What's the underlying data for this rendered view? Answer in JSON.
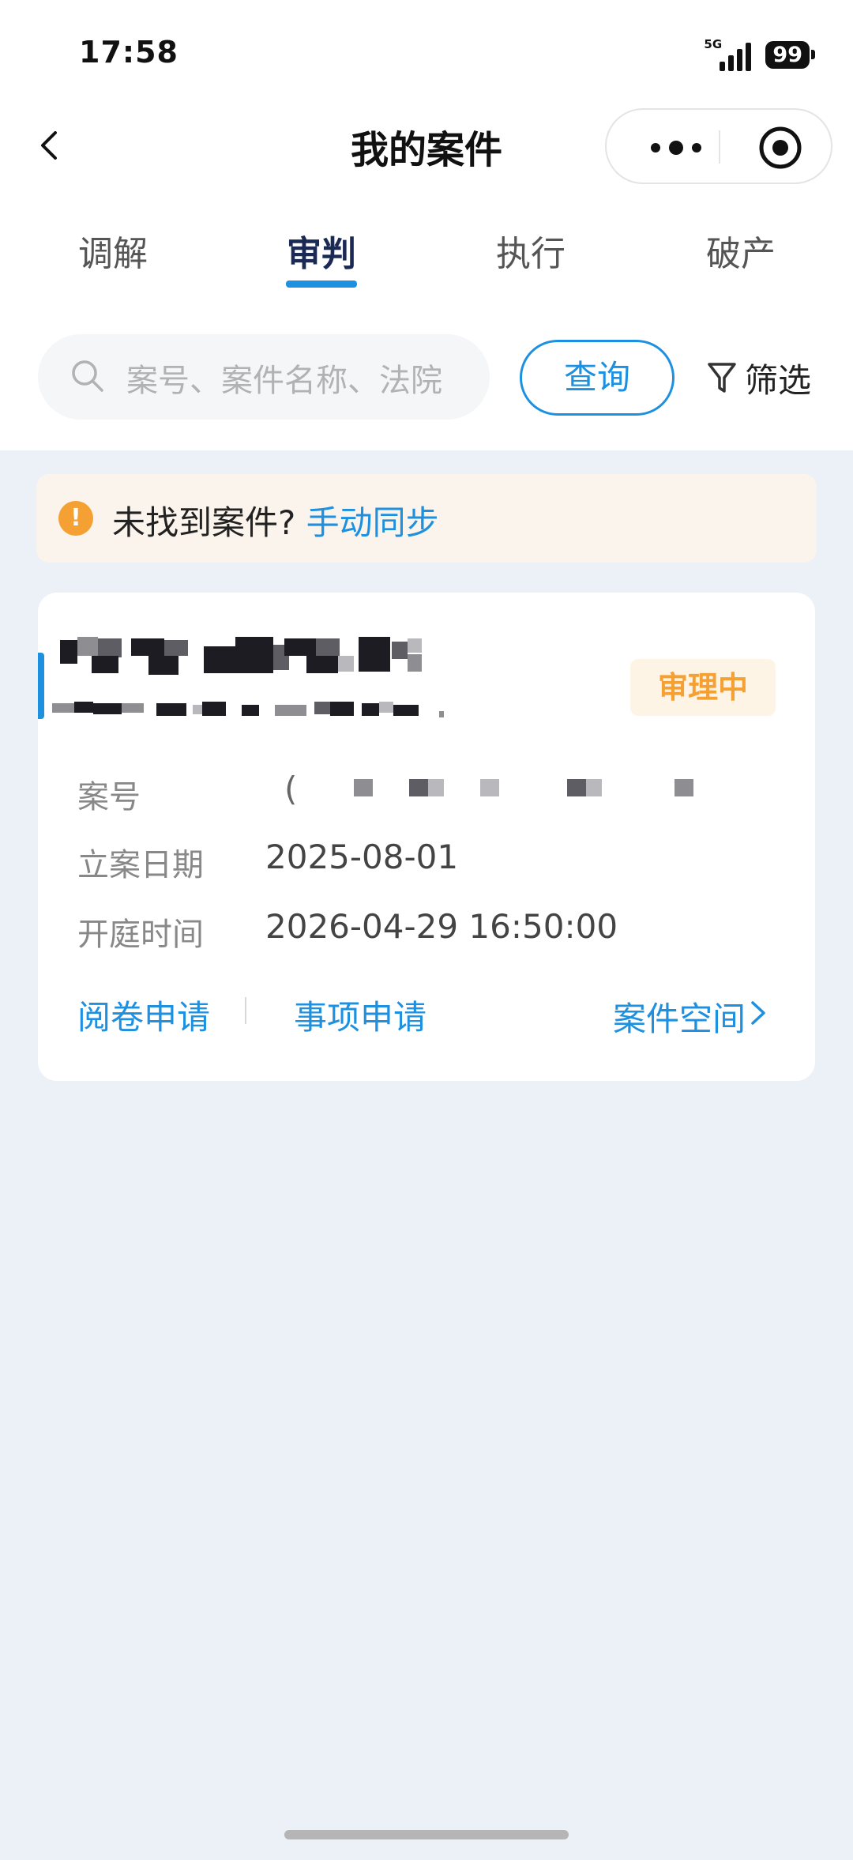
{
  "status_bar": {
    "time": "17:58",
    "network": "5G",
    "battery": "99"
  },
  "nav": {
    "title": "我的案件"
  },
  "tabs": [
    {
      "label": "调解",
      "active": false
    },
    {
      "label": "审判",
      "active": true
    },
    {
      "label": "执行",
      "active": false
    },
    {
      "label": "破产",
      "active": false
    }
  ],
  "search": {
    "placeholder": "案号、案件名称、法院",
    "query_label": "查询",
    "filter_label": "筛选"
  },
  "notice": {
    "text": "未找到案件?",
    "link": "手动同步"
  },
  "case": {
    "status": "审理中",
    "case_no_label": "案号",
    "case_no_prefix": "(",
    "filing_date_label": "立案日期",
    "filing_date": "2025-08-01",
    "hearing_time_label": "开庭时间",
    "hearing_time": "2026-04-29 16:50:00",
    "actions": {
      "read_files": "阅卷申请",
      "item_request": "事项申请",
      "case_space": "案件空间"
    }
  },
  "colors": {
    "accent": "#1E90E0",
    "status": "#F5A033",
    "title": "#1B2A55",
    "background": "#ECF0F7"
  }
}
